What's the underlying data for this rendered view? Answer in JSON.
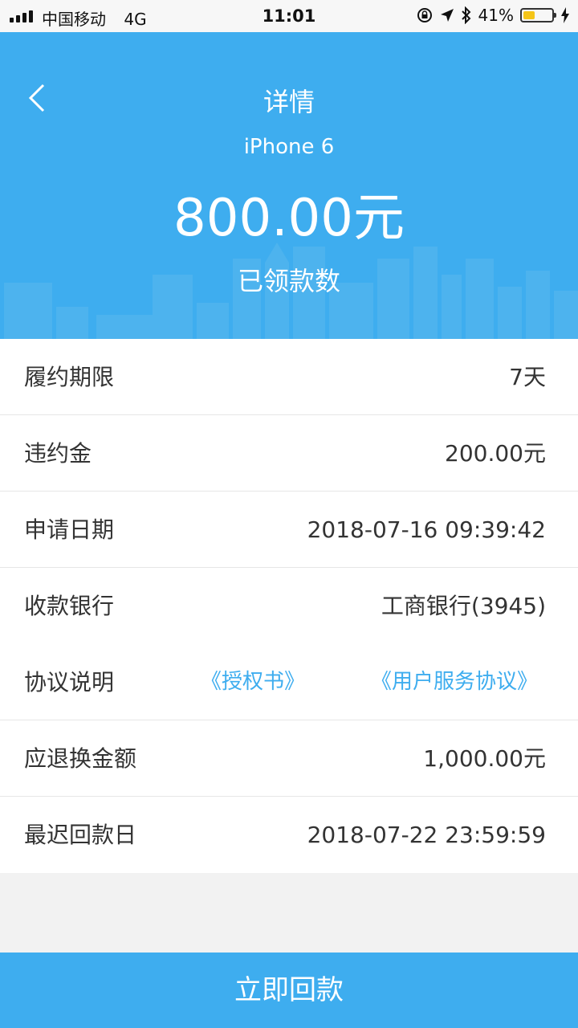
{
  "status_bar": {
    "carrier": "中国移动",
    "network": "4G",
    "time": "11:01",
    "battery_percent": "41%",
    "battery_level": 0.41
  },
  "header": {
    "title": "详情",
    "product": "iPhone 6",
    "amount": "800.00元",
    "amount_label": "已领款数"
  },
  "details": [
    {
      "label": "履约期限",
      "value": "7天"
    },
    {
      "label": "违约金",
      "value": "200.00元"
    },
    {
      "label": "申请日期",
      "value": "2018-07-16 09:39:42"
    },
    {
      "label": "收款银行",
      "value": "工商银行(3945)"
    },
    {
      "label": "应退换金额",
      "value": "1,000.00元"
    },
    {
      "label": "最迟回款日",
      "value": "2018-07-22 23:59:59"
    }
  ],
  "agreement": {
    "label": "协议说明",
    "link1": "《授权书》",
    "link2": "《用户服务协议》"
  },
  "action": {
    "button_label": "立即回款"
  },
  "colors": {
    "accent": "#3eadef",
    "background": "#f2f2f2"
  },
  "icons": [
    "signal-icon",
    "lock-rotation-icon",
    "location-arrow-icon",
    "bluetooth-icon",
    "battery-icon",
    "charging-icon",
    "back-chevron-icon"
  ]
}
